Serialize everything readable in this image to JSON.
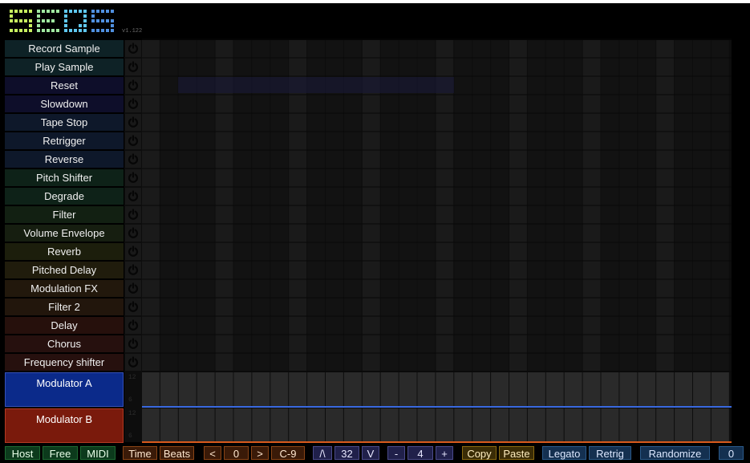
{
  "app": {
    "logo_text": "SEQS",
    "version": "v1.122"
  },
  "effects": [
    {
      "label": "Record Sample",
      "color": "#0e2226"
    },
    {
      "label": "Play Sample",
      "color": "#0e2226"
    },
    {
      "label": "Reset",
      "color": "#0e0e2a"
    },
    {
      "label": "Slowdown",
      "color": "#0e0e2a"
    },
    {
      "label": "Tape Stop",
      "color": "#0e182a"
    },
    {
      "label": "Retrigger",
      "color": "#0e182a"
    },
    {
      "label": "Reverse",
      "color": "#0e182a"
    },
    {
      "label": "Pitch Shifter",
      "color": "#0e2218"
    },
    {
      "label": "Degrade",
      "color": "#0e2218"
    },
    {
      "label": "Filter",
      "color": "#122012"
    },
    {
      "label": "Volume Envelope",
      "color": "#161e10"
    },
    {
      "label": "Reverb",
      "color": "#1c1e0c"
    },
    {
      "label": "Pitched Delay",
      "color": "#201c0c"
    },
    {
      "label": "Modulation FX",
      "color": "#22180c"
    },
    {
      "label": "Filter 2",
      "color": "#22160c"
    },
    {
      "label": "Delay",
      "color": "#26100c"
    },
    {
      "label": "Chorus",
      "color": "#26100e"
    },
    {
      "label": "Frequency shifter",
      "color": "#26100e"
    }
  ],
  "modulators": {
    "a": {
      "label": "Modulator A",
      "color": "#0b2a8a",
      "scale_top": "12",
      "scale_bottom": "6"
    },
    "b": {
      "label": "Modulator B",
      "color": "#7a1a0c",
      "scale_top": "12",
      "scale_bottom": "6"
    }
  },
  "grid": {
    "steps": 32
  },
  "toolbar": {
    "host": "Host",
    "free": "Free",
    "midi": "MIDI",
    "time": "Time",
    "beats": "Beats",
    "prev": "<",
    "offset": "0",
    "next": ">",
    "note": "C-9",
    "up": "/\\",
    "length": "32",
    "down": "V",
    "minus": "-",
    "division": "4",
    "plus": "+",
    "copy": "Copy",
    "paste": "Paste",
    "legato": "Legato",
    "retrig": "Retrig",
    "randomize": "Randomize",
    "counter": "0"
  },
  "colors": {
    "accent_blue": "#3a6ae0",
    "accent_orange": "#d85a1c"
  }
}
